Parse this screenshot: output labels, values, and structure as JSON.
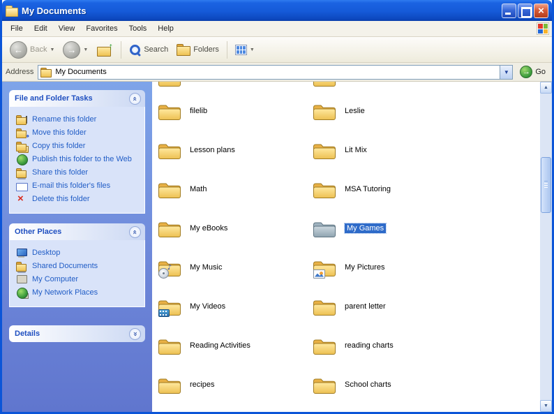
{
  "window": {
    "title": "My Documents"
  },
  "colors": {
    "titlebar": "#155ad8",
    "selection": "#2e6bc9",
    "task_link": "#215dc6",
    "folder_yellow": "#eec253"
  },
  "menu": {
    "items": [
      "File",
      "Edit",
      "View",
      "Favorites",
      "Tools",
      "Help"
    ]
  },
  "toolbar": {
    "back_label": "Back",
    "search_label": "Search",
    "folders_label": "Folders"
  },
  "address": {
    "label": "Address",
    "value": "My Documents",
    "go_label": "Go"
  },
  "sidebar": {
    "file_tasks": {
      "title": "File and Folder Tasks",
      "items": [
        {
          "label": "Rename this folder",
          "icon": "rename-folder-icon"
        },
        {
          "label": "Move this folder",
          "icon": "move-folder-icon"
        },
        {
          "label": "Copy this folder",
          "icon": "copy-folder-icon"
        },
        {
          "label": "Publish this folder to the Web",
          "icon": "publish-web-icon"
        },
        {
          "label": "Share this folder",
          "icon": "share-folder-icon"
        },
        {
          "label": "E-mail this folder's files",
          "icon": "email-icon"
        },
        {
          "label": "Delete this folder",
          "icon": "delete-icon"
        }
      ]
    },
    "other_places": {
      "title": "Other Places",
      "items": [
        {
          "label": "Desktop",
          "icon": "desktop-icon"
        },
        {
          "label": "Shared Documents",
          "icon": "shared-folder-icon"
        },
        {
          "label": "My Computer",
          "icon": "my-computer-icon"
        },
        {
          "label": "My Network Places",
          "icon": "network-places-icon"
        }
      ]
    },
    "details": {
      "title": "Details"
    }
  },
  "folders": {
    "selected": "My Games",
    "items": [
      {
        "label": "filelib",
        "icon": "folder-icon"
      },
      {
        "label": "Leslie",
        "icon": "folder-icon"
      },
      {
        "label": "Lesson plans",
        "icon": "folder-icon"
      },
      {
        "label": "Lit Mix",
        "icon": "folder-icon"
      },
      {
        "label": "Math",
        "icon": "folder-icon"
      },
      {
        "label": "MSA Tutoring",
        "icon": "folder-icon"
      },
      {
        "label": "My eBooks",
        "icon": "folder-icon"
      },
      {
        "label": "My Games",
        "icon": "games-folder-icon",
        "selected": true
      },
      {
        "label": "My Music",
        "icon": "music-folder-icon"
      },
      {
        "label": "My Pictures",
        "icon": "pictures-folder-icon"
      },
      {
        "label": "My Videos",
        "icon": "videos-folder-icon"
      },
      {
        "label": "parent letter",
        "icon": "folder-icon"
      },
      {
        "label": "Reading Activities",
        "icon": "folder-icon"
      },
      {
        "label": "reading charts",
        "icon": "folder-icon"
      },
      {
        "label": "recipes",
        "icon": "folder-icon"
      },
      {
        "label": "School charts",
        "icon": "folder-icon"
      }
    ]
  }
}
